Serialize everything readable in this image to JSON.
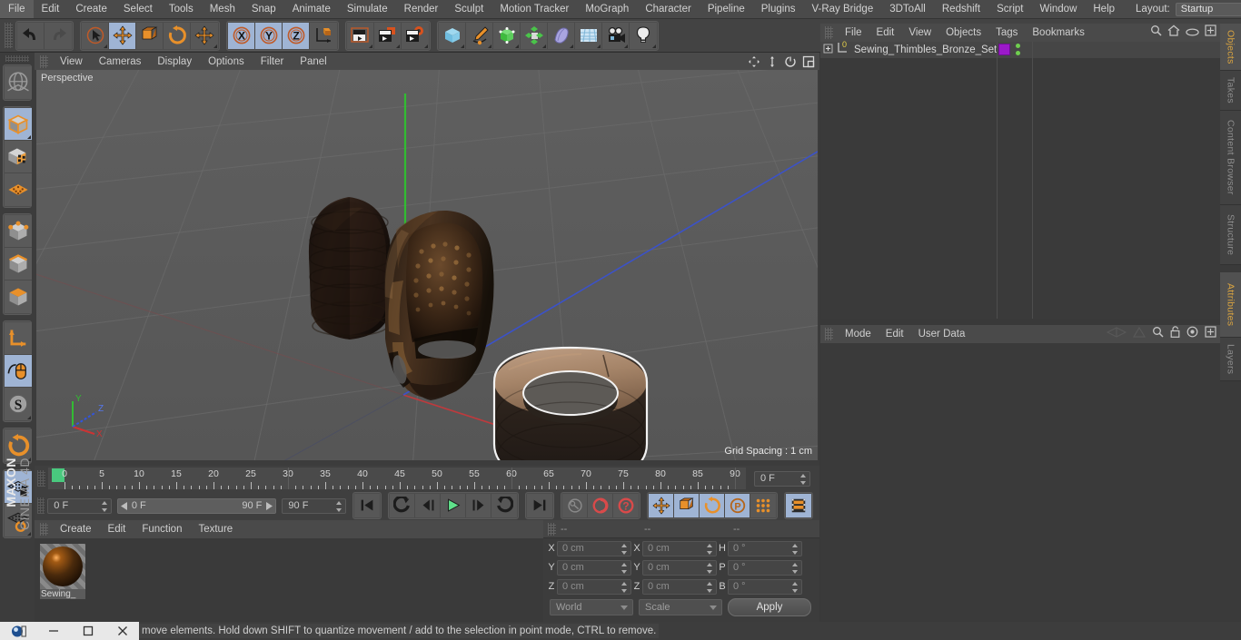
{
  "menubar": {
    "items": [
      "File",
      "Edit",
      "Create",
      "Select",
      "Tools",
      "Mesh",
      "Snap",
      "Animate",
      "Simulate",
      "Render",
      "Sculpt",
      "Motion Tracker",
      "MoGraph",
      "Character",
      "Pipeline",
      "Plugins",
      "V-Ray Bridge",
      "3DToAll",
      "Redshift",
      "Script",
      "Window",
      "Help"
    ],
    "layout_label": "Layout:",
    "layout_value": "Startup",
    "search_icon": "search-icon"
  },
  "toolbar": {
    "groups": [
      {
        "name": "undo-redo",
        "buttons": [
          {
            "icon": "undo-icon",
            "active": false,
            "corner": false
          },
          {
            "icon": "redo-icon",
            "active": false,
            "corner": false
          }
        ]
      },
      {
        "name": "transform-tools",
        "buttons": [
          {
            "icon": "select-cursor-icon",
            "active": false,
            "corner": true
          },
          {
            "icon": "move-icon",
            "active": true,
            "corner": false
          },
          {
            "icon": "scale-icon",
            "active": false,
            "corner": false
          },
          {
            "icon": "rotate-icon",
            "active": false,
            "corner": false
          },
          {
            "icon": "move-alt-icon",
            "active": false,
            "corner": true
          }
        ]
      },
      {
        "name": "axis-locks",
        "buttons": [
          {
            "icon": "x-axis-icon",
            "active": true,
            "corner": false
          },
          {
            "icon": "y-axis-icon",
            "active": true,
            "corner": false
          },
          {
            "icon": "z-axis-icon",
            "active": true,
            "corner": false
          },
          {
            "icon": "world-axis-icon",
            "active": false,
            "corner": false
          }
        ]
      },
      {
        "name": "render-tools",
        "buttons": [
          {
            "icon": "render-view-icon",
            "active": false,
            "corner": true
          },
          {
            "icon": "render-region-icon",
            "active": false,
            "corner": true
          },
          {
            "icon": "render-settings-icon",
            "active": false,
            "corner": true
          }
        ]
      },
      {
        "name": "create-objects",
        "buttons": [
          {
            "icon": "cube-primitive-icon",
            "active": false,
            "corner": true
          },
          {
            "icon": "spline-pen-icon",
            "active": false,
            "corner": true
          },
          {
            "icon": "generator-icon",
            "active": false,
            "corner": true
          },
          {
            "icon": "array-icon",
            "active": false,
            "corner": true
          },
          {
            "icon": "deformer-icon",
            "active": false,
            "corner": true
          },
          {
            "icon": "environment-icon",
            "active": false,
            "corner": true
          },
          {
            "icon": "camera-icon",
            "active": false,
            "corner": true
          },
          {
            "icon": "light-icon",
            "active": false,
            "corner": true
          }
        ]
      }
    ]
  },
  "lefttoolbar": {
    "groups": [
      {
        "buttons": [
          {
            "icon": "viewport-globe-icon",
            "active": false,
            "corner": false
          }
        ]
      },
      {
        "buttons": [
          {
            "icon": "editable-object-icon",
            "active": true,
            "corner": true
          },
          {
            "icon": "texture-mode-icon",
            "active": false,
            "corner": false
          },
          {
            "icon": "polygon-grid-icon",
            "active": false,
            "corner": false
          }
        ]
      },
      {
        "buttons": [
          {
            "icon": "point-mode-icon",
            "active": false,
            "corner": false
          },
          {
            "icon": "edge-mode-icon",
            "active": false,
            "corner": false
          },
          {
            "icon": "polygon-mode-icon",
            "active": false,
            "corner": false
          }
        ]
      },
      {
        "buttons": [
          {
            "icon": "axis-modify-icon",
            "active": false,
            "corner": false
          },
          {
            "icon": "viewport-solo-mouse-icon",
            "active": true,
            "corner": false
          },
          {
            "icon": "snap-s-icon",
            "active": false,
            "corner": true
          }
        ]
      },
      {
        "buttons": [
          {
            "icon": "workplane-rotate-icon",
            "active": false,
            "corner": true
          }
        ]
      },
      {
        "buttons": [
          {
            "icon": "workplane-lock-icon",
            "active": true,
            "corner": false
          },
          {
            "icon": "workplane-cycle-icon",
            "active": false,
            "corner": true
          }
        ]
      }
    ],
    "brand_top": "MAXON",
    "brand_bottom": "CINEMA 4D"
  },
  "viewport": {
    "menu": [
      "View",
      "Cameras",
      "Display",
      "Options",
      "Filter",
      "Panel"
    ],
    "nav_icons": [
      "pan-icon",
      "zoom-icon",
      "orbit-icon",
      "maximize-icon"
    ],
    "perspective_label": "Perspective",
    "grid_spacing_label": "Grid Spacing : 1 cm",
    "axis_labels": {
      "x": "X",
      "y": "Y",
      "z": "Z"
    },
    "axis_colors": {
      "x": "#cc3333",
      "y": "#33bb33",
      "z": "#3355dd"
    }
  },
  "timeline": {
    "ticks": [
      0,
      5,
      10,
      15,
      20,
      25,
      30,
      35,
      40,
      45,
      50,
      55,
      60,
      65,
      70,
      75,
      80,
      85,
      90
    ],
    "current_frame_field": "0 F",
    "playhead_frame": 0
  },
  "transport": {
    "start_field": "0 F",
    "range_start": "0 F",
    "range_end": "90 F",
    "end_field": "90 F",
    "buttons": [
      {
        "icon": "go-to-start-icon",
        "active": false
      },
      {
        "icon": "previous-key-icon",
        "active": false
      },
      {
        "icon": "step-back-icon",
        "active": false
      },
      {
        "icon": "play-icon",
        "active": false
      },
      {
        "icon": "step-forward-icon",
        "active": false
      },
      {
        "icon": "next-key-icon",
        "active": false
      },
      {
        "icon": "go-to-end-icon",
        "active": false
      },
      {
        "icon": "record-key-icon",
        "active": false
      },
      {
        "icon": "autokey-icon",
        "active": false
      },
      {
        "icon": "keyframe-help-icon",
        "active": false
      },
      {
        "icon": "key-position-icon",
        "active": true
      },
      {
        "icon": "key-scale-icon",
        "active": true
      },
      {
        "icon": "key-rotation-icon",
        "active": true
      },
      {
        "icon": "key-param-icon",
        "active": true
      },
      {
        "icon": "key-points-icon",
        "active": false
      },
      {
        "icon": "timeline-toggle-icon",
        "active": true
      }
    ]
  },
  "material_manager": {
    "menu": [
      "Create",
      "Edit",
      "Function",
      "Texture"
    ],
    "materials": [
      {
        "name": "Sewing_",
        "swatch": "bronze-sphere"
      }
    ]
  },
  "coordinates": {
    "header_dashes": [
      "--",
      "--",
      "--"
    ],
    "rows": [
      {
        "label_pos": "X",
        "value_pos": "0 cm",
        "label_size": "X",
        "value_size": "0 cm",
        "label_rot": "H",
        "value_rot": "0 °"
      },
      {
        "label_pos": "Y",
        "value_pos": "0 cm",
        "label_size": "Y",
        "value_size": "0 cm",
        "label_rot": "P",
        "value_rot": "0 °"
      },
      {
        "label_pos": "Z",
        "value_pos": "0 cm",
        "label_size": "Z",
        "value_size": "0 cm",
        "label_rot": "B",
        "value_rot": "0 °"
      }
    ],
    "space_select": "World",
    "mode_select": "Scale",
    "apply_label": "Apply"
  },
  "object_manager": {
    "menu": [
      "File",
      "Edit",
      "View",
      "Objects",
      "Tags",
      "Bookmarks"
    ],
    "icons": [
      "search-icon",
      "home-icon",
      "eye-icon",
      "new-window-icon"
    ],
    "objects": [
      {
        "name": "Sewing_Thimbles_Bronze_Set",
        "expand": "+",
        "layer_badge": "0",
        "tag_color": "#9b19c9",
        "has_tag": true
      }
    ]
  },
  "attributes": {
    "menu": [
      "Mode",
      "Edit",
      "User Data"
    ],
    "icons": [
      "flatten-icon",
      "pin-icon",
      "search-icon",
      "lock-icon",
      "target-icon",
      "new-window-icon"
    ]
  },
  "vertical_tabs": {
    "top": [
      {
        "label": "Objects",
        "active": true
      },
      {
        "label": "Takes",
        "active": false
      },
      {
        "label": "Content Browser",
        "active": false
      },
      {
        "label": "Structure",
        "active": false
      }
    ],
    "bottom": [
      {
        "label": "Attributes",
        "active": true
      },
      {
        "label": "Layers",
        "active": false
      }
    ]
  },
  "statusbar": {
    "text": "move elements. Hold down SHIFT to quantize movement / add to the selection in point mode, CTRL to remove."
  },
  "taskbar": {
    "items": [
      "c4d-app-icon",
      "window-restore-icon",
      "window-maximize-icon",
      "window-close-icon"
    ]
  }
}
